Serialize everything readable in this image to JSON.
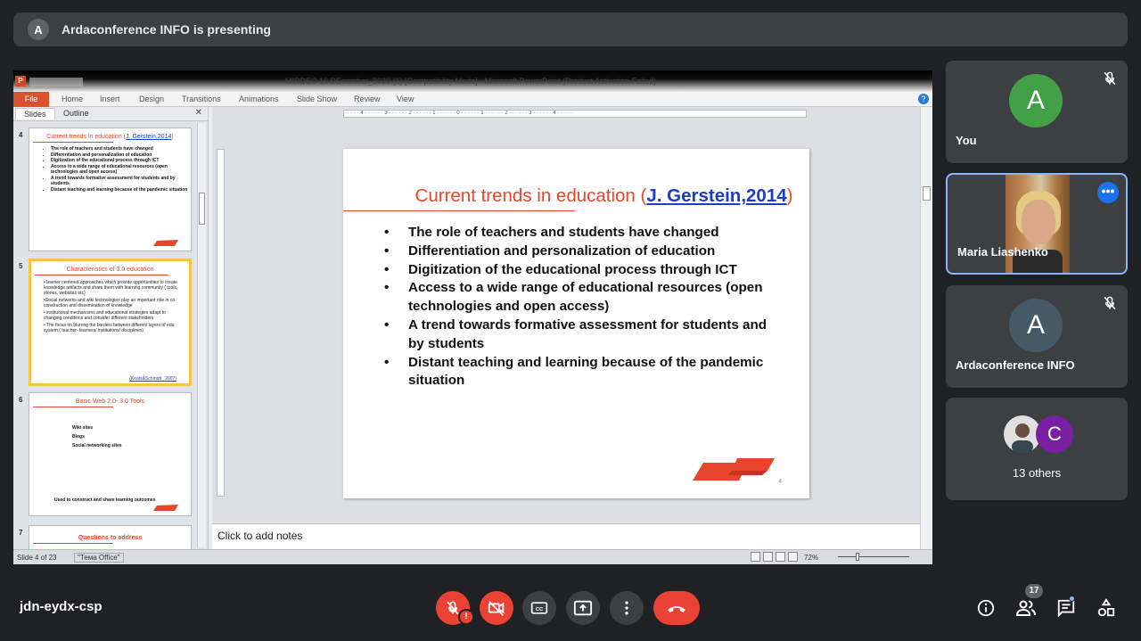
{
  "banner": {
    "avatar_letter": "A",
    "text": "Ardaconference INFO is presenting"
  },
  "ppt": {
    "window_title": "MIRDEC 16 DEcember_2020 (1) [Compatibility Mode] - Microsoft PowerPoint (Product Activation Failed)",
    "ribbon_tabs": [
      "File",
      "Home",
      "Insert",
      "Design",
      "Transitions",
      "Animations",
      "Slide Show",
      "Review",
      "View"
    ],
    "pane_tabs": [
      "Slides",
      "Outline"
    ],
    "thumbs": [
      {
        "num": "4",
        "title": "Current trends in education (",
        "title_link": "J. Gerstein,2014",
        "title_end": ")",
        "bullets": [
          "The role of teachers and students have changed",
          "Differentiation and personalization of education",
          "Digitization of the educational process through ICT",
          "Access to a wide range of educational resources (open technologies and open access)",
          "A trend towards formative assessment for students and by students",
          "Distant teaching and learning because of the pandemic situation"
        ]
      },
      {
        "num": "5",
        "title": "Characteristics of 3.0 education",
        "paras": [
          "• learner centered approaches which provide opportunities to create knowledge artifacts and share them with learning community ( tools, stories, websites etc)",
          "•Social networks and wiki technologies play an important role in co construction and dissemination of knowledge",
          "• institutional mechanisms and educational strategies adapt to changing conditions and consider different stakeholders",
          "• The focus on blurring the borders between different layers of edu system ( teacher- learners/ institutions/ disciplines)"
        ],
        "ref": "(Keats&Schmidt , 2007)"
      },
      {
        "num": "6",
        "title": "Basic Web 2.0- 3.0 Tools",
        "items": [
          "Wiki sites",
          "Blogs",
          "Social networking sites"
        ],
        "foot": "Used to construct and share learning outcomes"
      },
      {
        "num": "7",
        "title": "Questions to address"
      }
    ],
    "ruler": "· · · · · 4 · · · · · · 3 · · · · · · 2 · · · · · · 1 · · · · · · 0 · · · · · · 1 · · · · · · 2 · · · · · · 3 · · · · · · 4 · · · · ·",
    "slide": {
      "title_pre": "Current trends in education (",
      "title_link": "J. Gerstein,2014",
      "title_post": ")",
      "bullets": [
        "The role of teachers and students have changed",
        "Differentiation and personalization of education",
        "Digitization of the educational process through ICT",
        "Access to a wide range of educational resources (open technologies and open access)",
        "A trend towards formative assessment for students and by students",
        "Distant teaching and learning because of the pandemic situation"
      ],
      "page_number": "4"
    },
    "notes_placeholder": "Click to add notes",
    "status_slide": "Slide 4 of 23",
    "status_theme": "\"Тема Office\"",
    "zoom": "72%",
    "accent": "#e8452c",
    "link_color": "#1a3fc4"
  },
  "participants": {
    "you": {
      "letter": "A",
      "name": "You",
      "color": "#43a047"
    },
    "maria": {
      "name": "Maria Liashenko"
    },
    "arda": {
      "letter": "A",
      "name": "Ardaconference INFO",
      "color": "#455a64"
    },
    "others": {
      "letter": "C",
      "label": "13 others",
      "color": "#7b1fa2"
    }
  },
  "meeting_code": "jdn-eydx-csp",
  "people_count": "17",
  "icons": [
    "mic-off-icon",
    "camera-off-icon",
    "captions-icon",
    "present-icon",
    "more-vert-icon",
    "end-call-icon",
    "info-icon",
    "people-icon",
    "chat-icon",
    "activities-icon"
  ]
}
